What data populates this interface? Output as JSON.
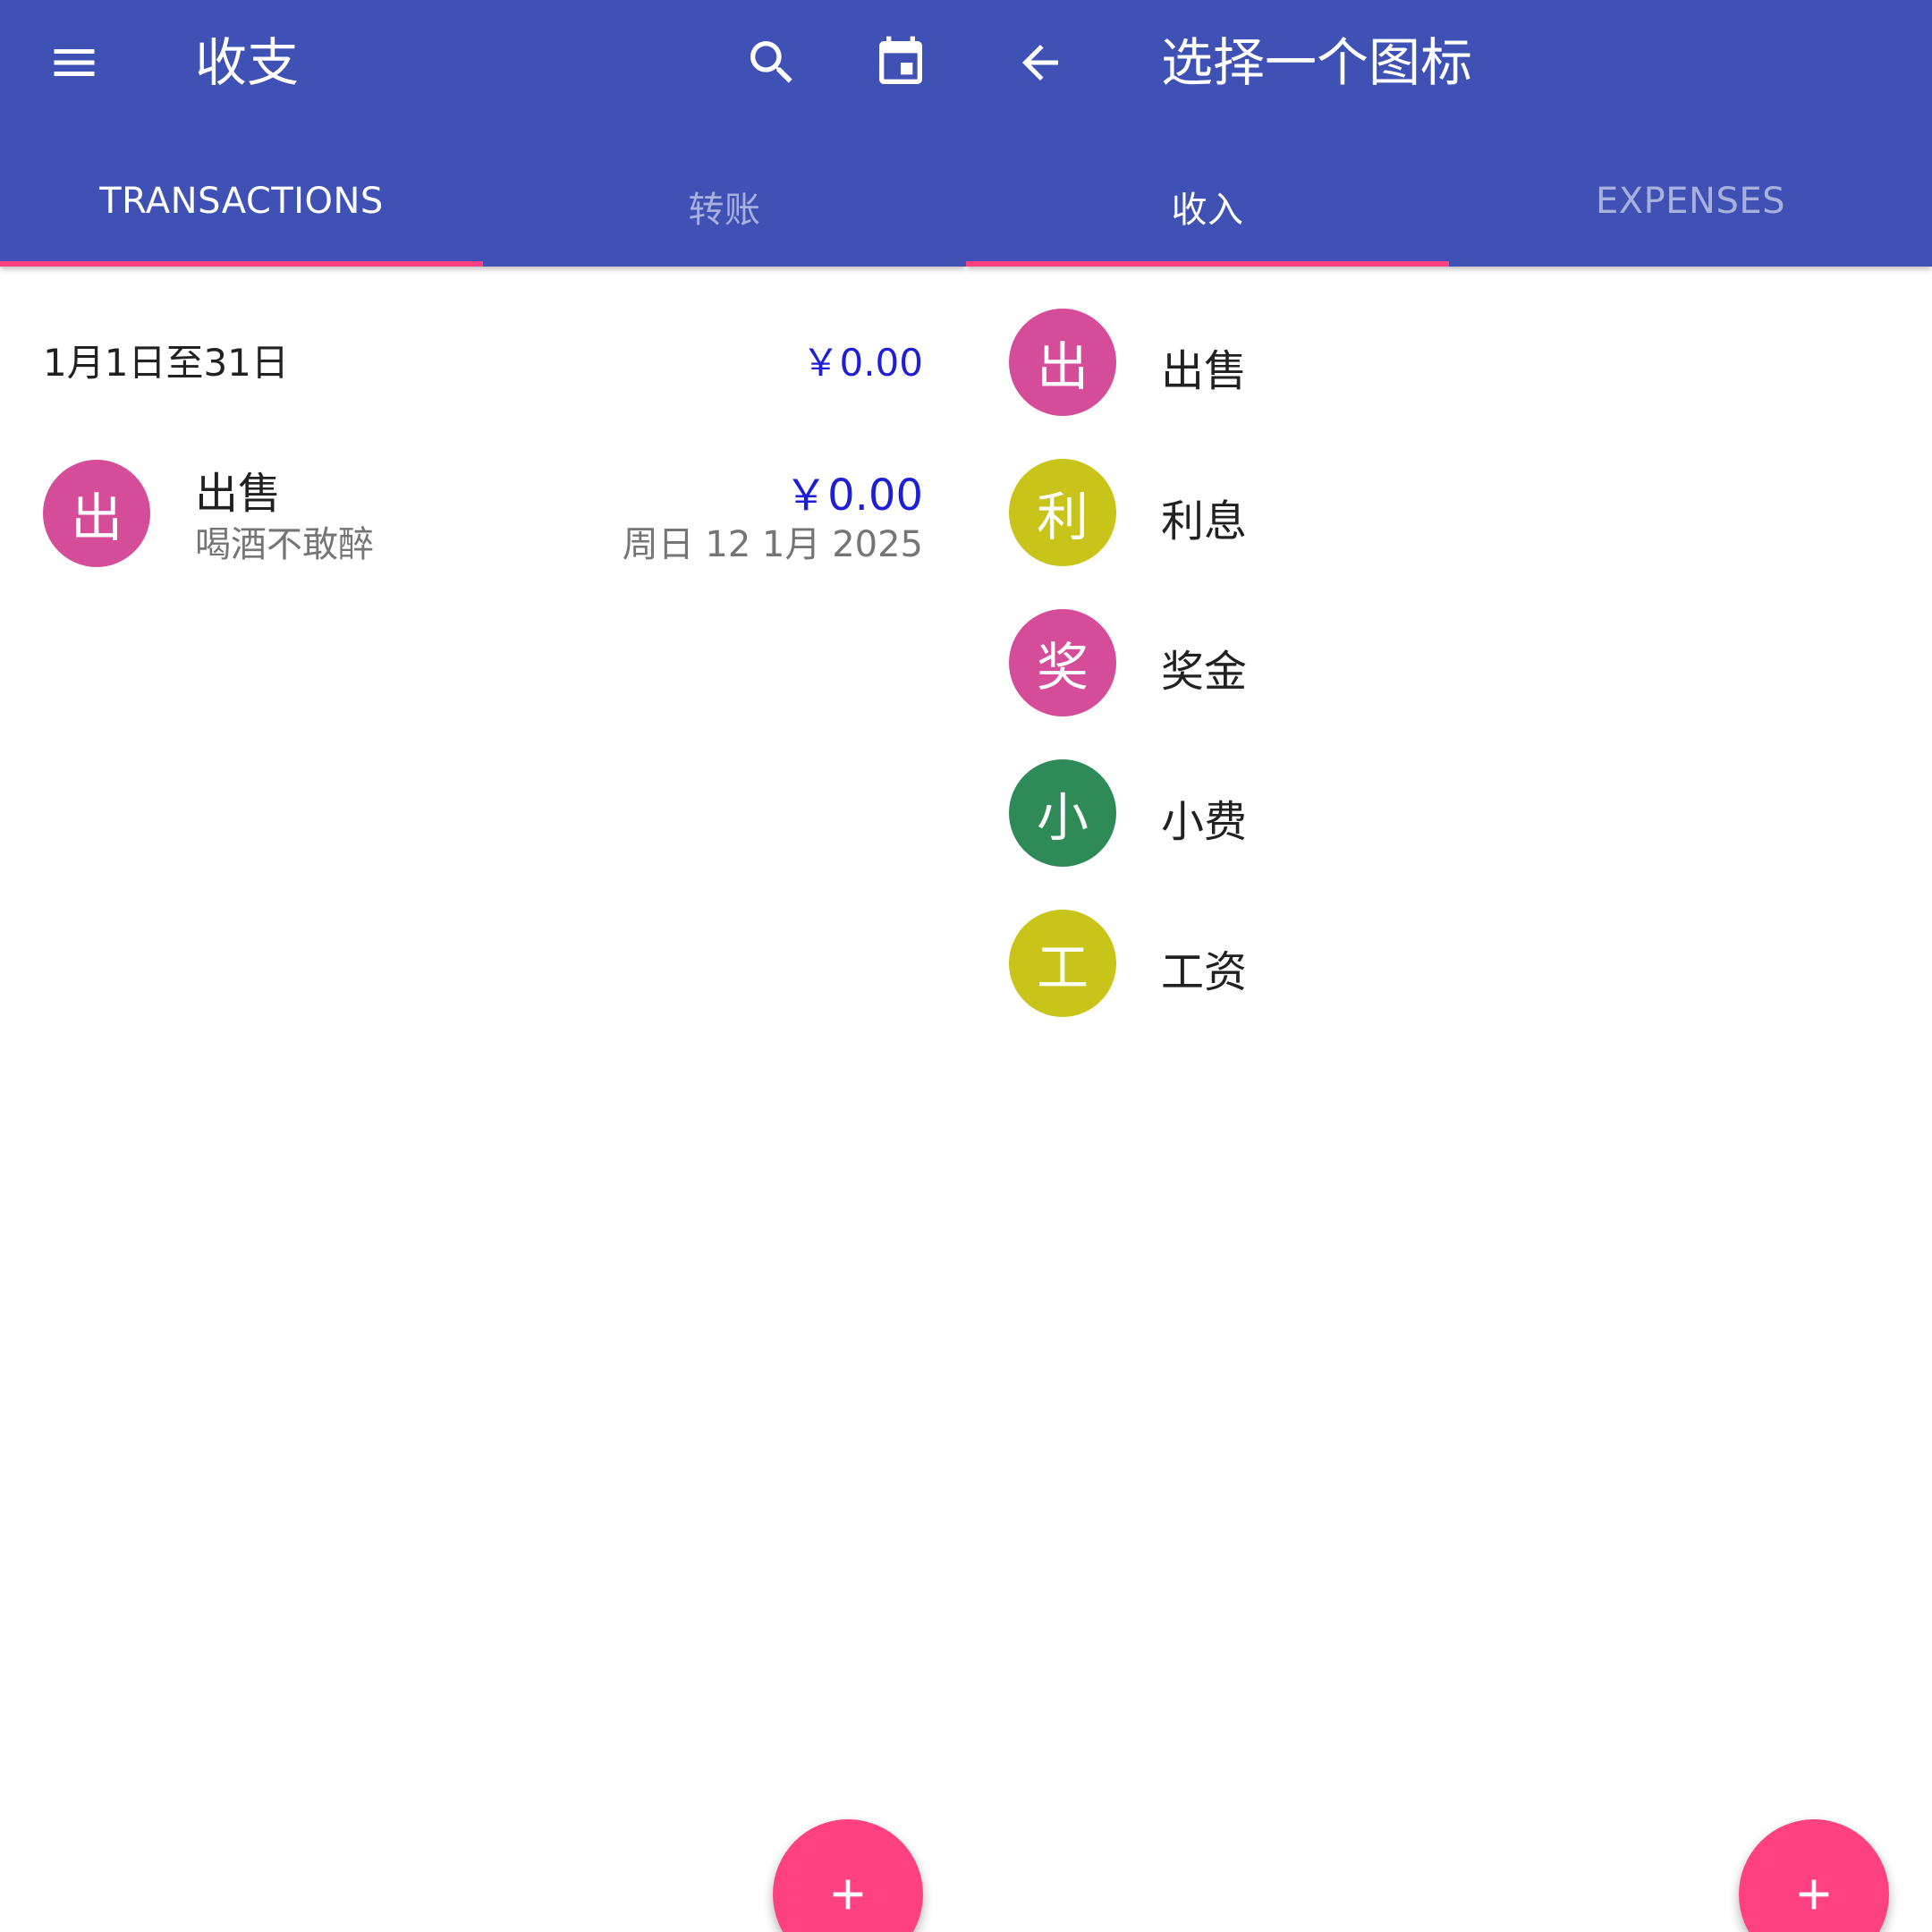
{
  "left_screen": {
    "toolbar": {
      "menu_icon": "menu-icon",
      "title": "收支",
      "search_icon": "search-icon",
      "calendar_icon": "calendar-icon"
    },
    "tabs": [
      {
        "label": "TRANSACTIONS",
        "active": true
      },
      {
        "label": "转账",
        "active": false
      }
    ],
    "summary": {
      "range": "1月1日至31日",
      "total": "￥0.00"
    },
    "transactions": [
      {
        "avatar_letter": "出",
        "avatar_color": "#d54c98",
        "title": "出售",
        "note": "喝酒不敢醉",
        "amount": "￥0.00",
        "date": "周日 12 1月 2025"
      }
    ],
    "fab_icon": "add-icon"
  },
  "right_screen": {
    "toolbar": {
      "back_icon": "arrow-back-icon",
      "title": "选择一个图标"
    },
    "tabs": [
      {
        "label": "收入",
        "active": true
      },
      {
        "label": "EXPENSES",
        "active": false
      }
    ],
    "icons": [
      {
        "letter": "出",
        "name": "出售",
        "color": "#d54c98"
      },
      {
        "letter": "利",
        "name": "利息",
        "color": "#c9c41a"
      },
      {
        "letter": "奖",
        "name": "奖金",
        "color": "#d54c98"
      },
      {
        "letter": "小",
        "name": "小费",
        "color": "#2e8b57"
      },
      {
        "letter": "工",
        "name": "工资",
        "color": "#c9c41a"
      }
    ],
    "fab_icon": "add-icon"
  },
  "colors": {
    "primary": "#3f51b5",
    "accent": "#ff4081",
    "amount_blue": "#1e1ed6"
  }
}
